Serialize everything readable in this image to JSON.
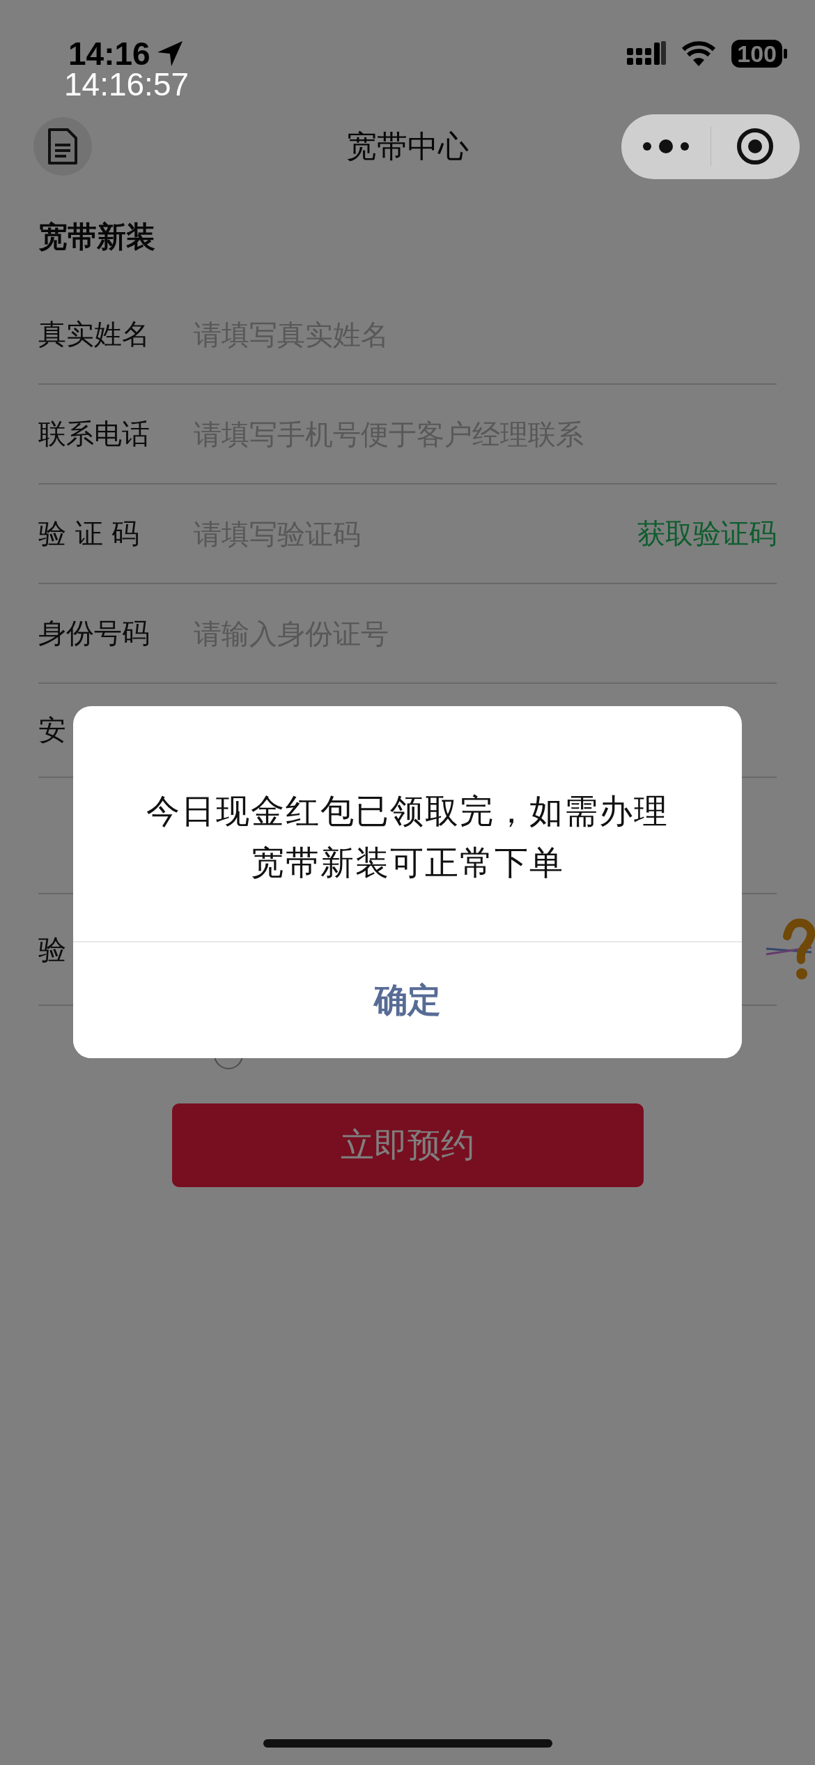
{
  "status_bar": {
    "time": "14:16",
    "recording_clock": "14:16:57",
    "battery": "100"
  },
  "nav": {
    "title": "宽带中心"
  },
  "section_title": "宽带新装",
  "fields": [
    {
      "kind": "input",
      "label": "真实姓名",
      "placeholder": "请填写真实姓名"
    },
    {
      "kind": "input",
      "label": "联系电话",
      "placeholder": "请填写手机号便于客户经理联系"
    },
    {
      "kind": "code",
      "label": "验 证 码",
      "placeholder": "请填写验证码",
      "action": "获取验证码"
    },
    {
      "kind": "input",
      "label": "身份号码",
      "placeholder": "请输入身份证号"
    },
    {
      "kind": "label",
      "label": "安"
    },
    {
      "kind": "blank"
    },
    {
      "kind": "captcha",
      "label": "验"
    }
  ],
  "agreement": {
    "checked": false
  },
  "submit": "立即预约",
  "dialog": {
    "message": "今日现金红包已领取完，如需办理宽带新装可正常下单",
    "button": "确定"
  }
}
